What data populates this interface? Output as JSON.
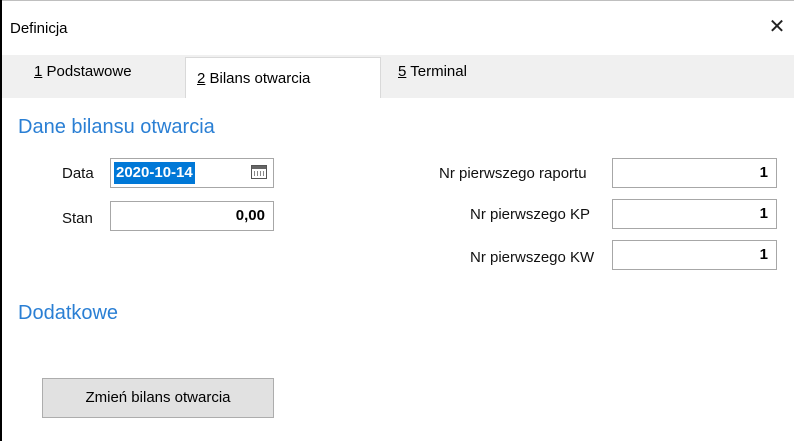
{
  "window": {
    "title": "Definicja",
    "close_glyph": "✕"
  },
  "tabs": [
    {
      "mnemonic": "1",
      "label": " Podstawowe"
    },
    {
      "mnemonic": "2",
      "label": " Bilans otwarcia"
    },
    {
      "mnemonic": "5",
      "label": " Terminal"
    }
  ],
  "opening": {
    "section_title": "Dane bilansu otwarcia",
    "date_label": "Data",
    "date_value": "2020-10-14",
    "state_label": "Stan",
    "state_value": "0,00"
  },
  "numbers": {
    "first_report_label": "Nr pierwszego raportu",
    "first_report_value": "1",
    "first_kp_label": "Nr pierwszego KP",
    "first_kp_value": "1",
    "first_kw_label": "Nr pierwszego KW",
    "first_kw_value": "1"
  },
  "extra": {
    "section_title": "Dodatkowe",
    "change_button_label": "Zmień bilans otwarcia"
  }
}
